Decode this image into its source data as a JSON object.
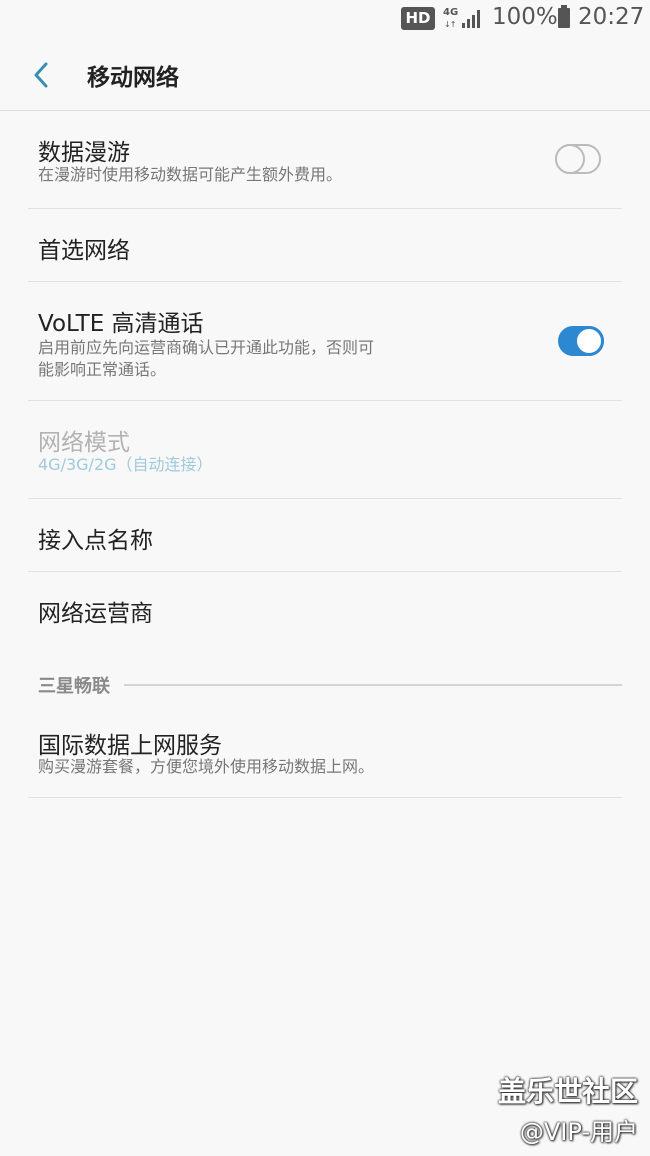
{
  "status_bar": {
    "hd_badge": "HD",
    "network_type": "4G",
    "network_arrows": "↓↑",
    "battery_percent": "100%",
    "time": "20:27",
    "icons": [
      "hd-badge",
      "4g-icon",
      "signal-icon",
      "battery-icon"
    ]
  },
  "header": {
    "title": "移动网络",
    "back_icon": "chevron-left-icon"
  },
  "items": [
    {
      "title": "数据漫游",
      "subtitle": "在漫游时使用移动数据可能产生额外费用。",
      "toggle": false,
      "enabled": true
    },
    {
      "title": "首选网络",
      "enabled": true
    },
    {
      "title": "VoLTE 高清通话",
      "subtitle_line1": "启用前应先向运营商确认已开通此功能，否则可",
      "subtitle_line2": "能影响正常通话。",
      "toggle": true,
      "enabled": true
    },
    {
      "title": "网络模式",
      "subtitle": "4G/3G/2G（自动连接）",
      "enabled": false
    },
    {
      "title": "接入点名称",
      "enabled": true
    },
    {
      "title": "网络运营商",
      "enabled": true
    }
  ],
  "section": {
    "label": "三星畅联"
  },
  "section_items": [
    {
      "title": "国际数据上网服务",
      "subtitle": "购买漫游套餐，方便您境外使用移动数据上网。",
      "enabled": true
    }
  ],
  "watermark": {
    "line1": "盖乐世社区",
    "line2": "@VIP-用户"
  },
  "colors": {
    "background": "#f8f8f8",
    "accent": "#2d88d2",
    "back_arrow": "#3a8fb0",
    "disabled_sub": "#9fcadb"
  }
}
